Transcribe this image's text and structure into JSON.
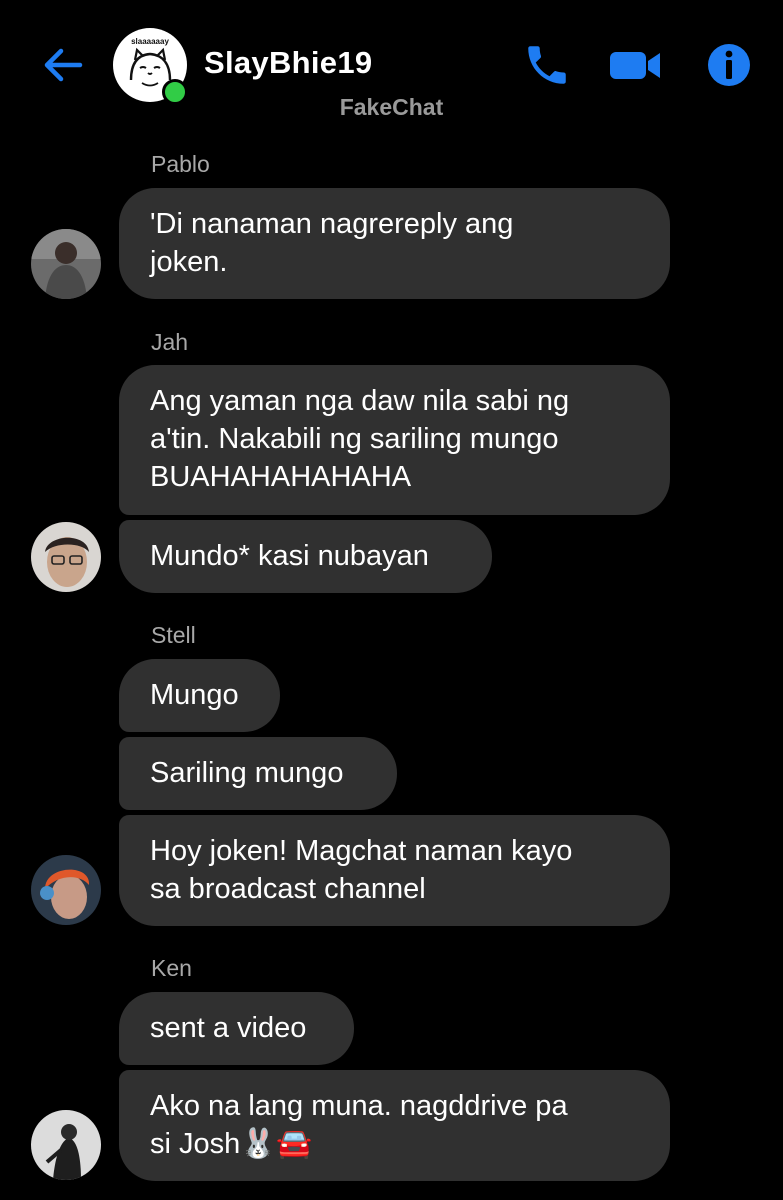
{
  "header": {
    "title": "SlayBhie19",
    "avatar_text": "slaaaaaay",
    "watermark": "FakeChat",
    "icons": {
      "back": "back-arrow-icon",
      "phone": "phone-icon",
      "video": "video-camera-icon",
      "info": "info-icon"
    },
    "accent_color": "#1e7cf2",
    "online_color": "#31cc46"
  },
  "messages": [
    {
      "sender": "Pablo",
      "bubbles": [
        "'Di nanaman nagrereply ang\njoken."
      ]
    },
    {
      "sender": "Jah",
      "bubbles": [
        "Ang yaman nga daw nila sabi ng\na'tin. Nakabili ng sariling mungo\nBUAHAHAHAHAHA",
        "Mundo* kasi nubayan"
      ]
    },
    {
      "sender": "Stell",
      "bubbles": [
        "Mungo",
        "Sariling mungo",
        "Hoy joken! Magchat naman kayo\nsa broadcast channel"
      ]
    },
    {
      "sender": "Ken",
      "bubbles": [
        "sent a video",
        "Ako na lang muna. nagddrive pa\nsi Josh🐰🚘"
      ]
    }
  ],
  "colors": {
    "background": "#000000",
    "bubble": "#303030",
    "sender_label": "#a8a8a8"
  }
}
